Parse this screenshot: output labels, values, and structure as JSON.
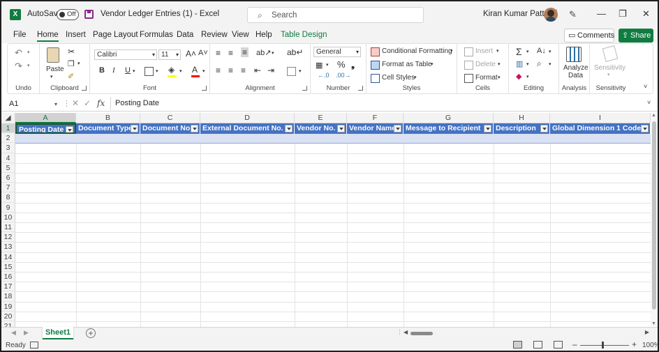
{
  "titlebar": {
    "autosave_label": "AutoSave",
    "autosave_state": "Off",
    "doc_title": "Vendor Ledger Entries (1)  -  Excel",
    "search_placeholder": "Search",
    "user_name": "Kiran Kumar Pattoori",
    "minimize": "—",
    "restore": "❐",
    "close": "✕"
  },
  "menu": {
    "items": [
      "File",
      "Home",
      "Insert",
      "Page Layout",
      "Formulas",
      "Data",
      "Review",
      "View",
      "Help",
      "Table Design"
    ],
    "active": "Home",
    "comments_label": "Comments",
    "share_label": "Share"
  },
  "ribbon": {
    "undo_group": "Undo",
    "clipboard": {
      "label": "Clipboard",
      "paste": "Paste"
    },
    "font": {
      "label": "Font",
      "font_name": "Calibri",
      "font_size": "11",
      "bold": "B",
      "italic": "I",
      "underline": "U"
    },
    "alignment": {
      "label": "Alignment"
    },
    "number": {
      "label": "Number",
      "format": "General",
      "percent": "%"
    },
    "styles": {
      "label": "Styles",
      "conditional": "Conditional Formatting",
      "format_table": "Format as Table",
      "cell_styles": "Cell Styles"
    },
    "cells": {
      "label": "Cells",
      "insert": "Insert",
      "delete": "Delete",
      "format": "Format"
    },
    "editing": {
      "label": "Editing"
    },
    "analysis": {
      "label": "Analysis",
      "analyze_line1": "Analyze",
      "analyze_line2": "Data"
    },
    "sensitivity": {
      "label": "Sensitivity",
      "button": "Sensitivity"
    }
  },
  "formula_bar": {
    "name_box": "A1",
    "fx": "fx",
    "content": "Posting Date"
  },
  "grid": {
    "columns": [
      "A",
      "B",
      "C",
      "D",
      "E",
      "F",
      "G",
      "H",
      "I"
    ],
    "rows": [
      "1",
      "2",
      "3",
      "4",
      "5",
      "6",
      "7",
      "8",
      "9",
      "10",
      "11",
      "12",
      "13",
      "14",
      "15",
      "16",
      "17",
      "18",
      "19",
      "20",
      "21"
    ],
    "table_headers": [
      "Posting Date",
      "Document Type",
      "Document No.",
      "External Document No.",
      "Vendor No.",
      "Vendor Name",
      "Message to Recipient",
      "Description",
      "Global Dimension 1 Code"
    ],
    "selected_cell": "A1",
    "header_color": "#4472c4",
    "band_color": "#d9e1f2"
  },
  "sheet_tabs": {
    "active": "Sheet1",
    "add": "+"
  },
  "status": {
    "ready": "Ready",
    "zoom": "100%",
    "minus": "–",
    "plus": "+"
  },
  "colors": {
    "excel_green": "#107c41",
    "table_blue": "#4472c4"
  }
}
